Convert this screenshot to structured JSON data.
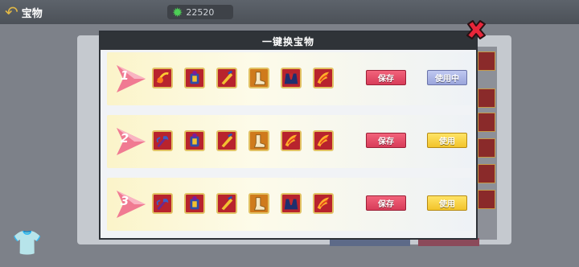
{
  "topbar": {
    "back_label": "宝物",
    "currency_value": "22520"
  },
  "modal": {
    "title": "一键换宝物"
  },
  "rows": [
    {
      "number": "1",
      "items": [
        "fire-bow-item",
        "armor-item",
        "blade-item",
        "boots-item",
        "cloak-item",
        "wings-item"
      ],
      "save_label": "保存",
      "use_label": "使用中",
      "in_use": true
    },
    {
      "number": "2",
      "items": [
        "axe-item",
        "armor-item",
        "blade-item",
        "boots-item",
        "wings-item",
        "wings-item"
      ],
      "save_label": "保存",
      "use_label": "使用",
      "in_use": false
    },
    {
      "number": "3",
      "items": [
        "axe-item",
        "armor-item",
        "blade-item",
        "boots-item",
        "cloak-item",
        "wings-item"
      ],
      "save_label": "保存",
      "use_label": "使用",
      "in_use": false
    }
  ],
  "colors": {
    "save": "#e24a64",
    "use": "#f5cf3a",
    "in_use": "#aab3e6",
    "header": "#2f3338"
  }
}
